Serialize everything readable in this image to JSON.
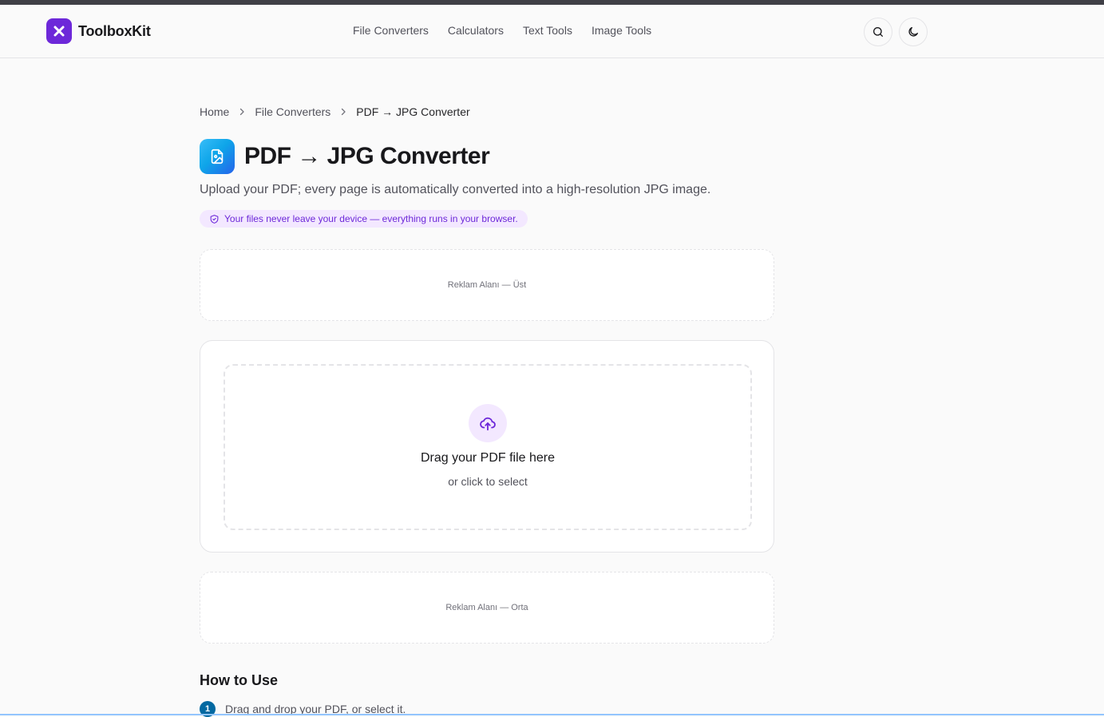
{
  "app": {
    "name": "ToolboxKit"
  },
  "nav": [
    {
      "label": "File Converters"
    },
    {
      "label": "Calculators"
    },
    {
      "label": "Text Tools"
    },
    {
      "label": "Image Tools"
    }
  ],
  "header_icons": {
    "search": "search-icon",
    "theme": "moon-icon"
  },
  "breadcrumb": [
    {
      "label": "Home"
    },
    {
      "label": "File Converters"
    },
    {
      "label": "PDF → JPG Converter"
    }
  ],
  "page": {
    "title": "PDF → JPG Converter",
    "subtitle": "Upload your PDF; every page is automatically converted into a high-resolution JPG image.",
    "privacy_note": "Your files never leave your device — everything runs in your browser."
  },
  "ads": {
    "top": "Reklam Alanı — Üst",
    "middle": "Reklam Alanı — Orta"
  },
  "upload": {
    "title": "Drag your PDF file here",
    "subtitle": "or click to select"
  },
  "howto": {
    "title": "How to Use",
    "steps": [
      {
        "num": "1",
        "text": "Drag and drop your PDF, or select it."
      }
    ]
  },
  "colors": {
    "brand": "#6d28d9",
    "accent_soft": "#f3e8ff",
    "step": "#0369a1"
  }
}
